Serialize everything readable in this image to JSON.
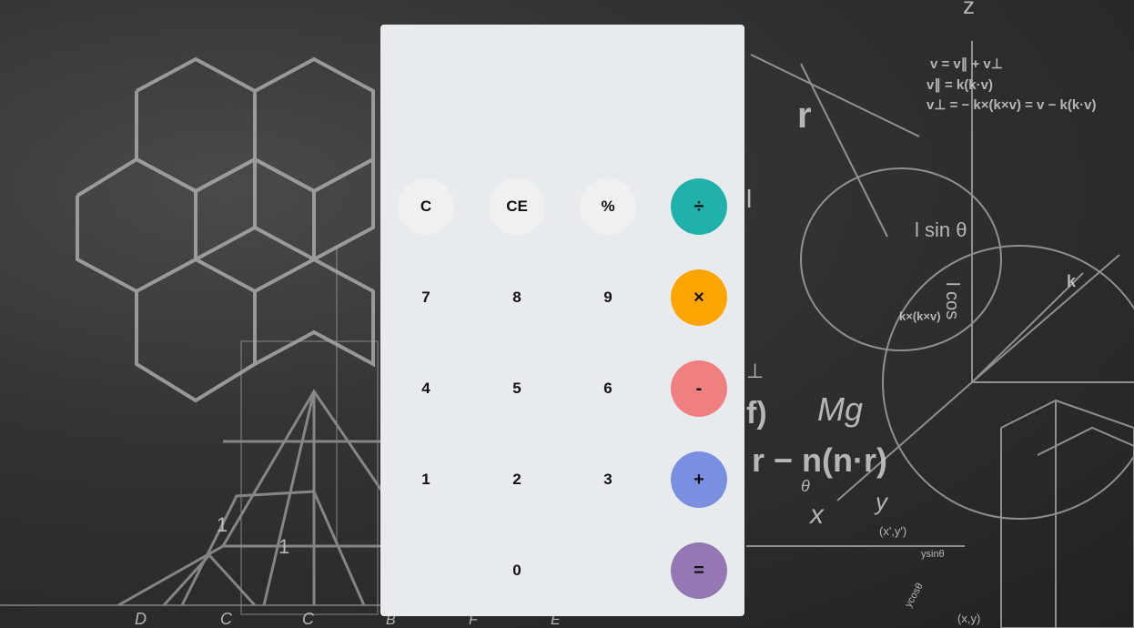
{
  "display": {
    "value": ""
  },
  "keys": {
    "clear": "C",
    "clear_entry": "CE",
    "percent": "%",
    "divide": "÷",
    "seven": "7",
    "eight": "8",
    "nine": "9",
    "multiply": "×",
    "four": "4",
    "five": "5",
    "six": "6",
    "subtract": "-",
    "one": "1",
    "two": "2",
    "three": "3",
    "add": "+",
    "zero": "0",
    "equals": "="
  },
  "colors": {
    "divide": "#20b2aa",
    "multiply": "#ffa500",
    "subtract": "#f08080",
    "add": "#7b8fe0",
    "equals": "#9478b3",
    "function_key": "#f1f0f0",
    "panel": "#e8ebee"
  },
  "background": {
    "chalk_text": {
      "z": "z",
      "eq1": "v = v∥ + v⊥",
      "eq2": "v∥ = k(k·v)",
      "eq3": "v⊥ = − k×(k×v) = v − k(k·v)",
      "r_perp": "r",
      "lsin": "l sin θ",
      "lcos": "l cos",
      "kxkxv": "k×(k×v)",
      "k": "k",
      "mg": "Mg",
      "f": "f)",
      "rn": "r − n(n·r)",
      "theta": "θ",
      "x": "x",
      "y": "y",
      "xy": "(x',y')",
      "perp": "⊥",
      "l": "l",
      "d": "D",
      "c1": "C",
      "c2": "C",
      "b": "B",
      "f2": "F",
      "e": "E",
      "one_a": "1",
      "one_b": "1",
      "ysin": "ysinθ",
      "ycos": "ycosθ",
      "xy2": "(x,y)"
    }
  }
}
